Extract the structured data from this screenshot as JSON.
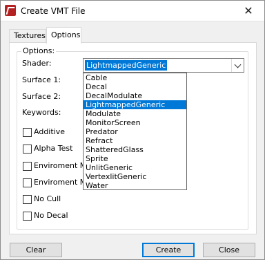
{
  "window": {
    "title": "Create VMT File",
    "close_glyph": "✕"
  },
  "tabs": [
    {
      "label": "Textures",
      "active": false
    },
    {
      "label": "Options",
      "active": true
    }
  ],
  "options_group": {
    "legend": "Options:",
    "shader_label": "Shader:",
    "surface1_label": "Surface 1:",
    "surface2_label": "Surface 2:",
    "keywords_label": "Keywords:"
  },
  "shader_combo": {
    "value": "LightmappedGeneric",
    "options": [
      "Cable",
      "Decal",
      "DecalModulate",
      "LightmappedGeneric",
      "Modulate",
      "MonitorScreen",
      "Predator",
      "Refract",
      "ShatteredGlass",
      "Sprite",
      "UnlitGeneric",
      "VertexlitGeneric",
      "Water"
    ],
    "selected_index": 3
  },
  "checkboxes": [
    {
      "label": "Additive",
      "checked": false
    },
    {
      "label": "Alpha Test",
      "checked": false
    },
    {
      "label": "Enviroment Map",
      "checked": false
    },
    {
      "label": "Enviroment Map",
      "checked": false
    },
    {
      "label": "No Cull",
      "checked": false
    },
    {
      "label": "No Decal",
      "checked": false
    }
  ],
  "buttons": {
    "clear": "Clear",
    "create": "Create",
    "close": "Close"
  },
  "colors": {
    "accent": "#0078d7",
    "app_icon": "#b22222"
  }
}
